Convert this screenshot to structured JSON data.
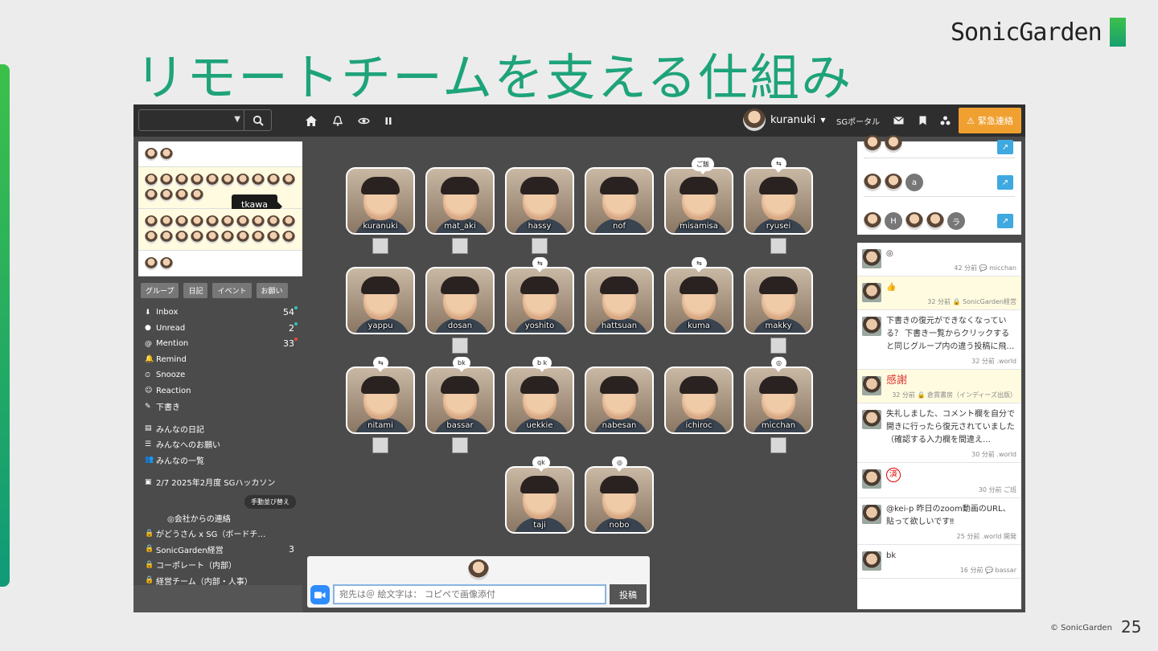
{
  "slide": {
    "title": "リモートチームを支える仕組み",
    "logo": "SonicGarden",
    "copyright": "© SonicGarden",
    "page": "25"
  },
  "topbar": {
    "user": "kuranuki",
    "portal": "SGポータル",
    "urgent": "緊急連絡"
  },
  "tooltip": "tkawa",
  "filters": [
    "グループ",
    "日記",
    "イベント",
    "お願い"
  ],
  "nav": [
    {
      "icon": "⬇",
      "label": "Inbox",
      "count": "54",
      "dot": "#2ec4b6"
    },
    {
      "icon": "●",
      "label": "Unread",
      "count": "2",
      "dot": "#2ec4b6"
    },
    {
      "icon": "@",
      "label": "Mention",
      "count": "33",
      "dot": "#e74c3c"
    },
    {
      "icon": "🔔",
      "label": "Remind",
      "count": "",
      "dot": ""
    },
    {
      "icon": "⏲",
      "label": "Snooze",
      "count": "",
      "dot": ""
    },
    {
      "icon": "☺",
      "label": "Reaction",
      "count": "",
      "dot": ""
    },
    {
      "icon": "✎",
      "label": "下書き",
      "count": "",
      "dot": ""
    }
  ],
  "nav2": [
    {
      "icon": "▤",
      "label": "みんなの日記"
    },
    {
      "icon": "☰",
      "label": "みんなへのお願い"
    },
    {
      "icon": "👥",
      "label": "みんなの一覧"
    }
  ],
  "event": "2/7 2025年2月度 SGハッカソン",
  "sort_button": "手動並び替え",
  "groups": [
    {
      "icon": "",
      "label": "◎会社からの連絡",
      "count": ""
    },
    {
      "icon": "🔒",
      "label": "がどうさん x SG（ボードチ…",
      "count": ""
    },
    {
      "icon": "🔒",
      "label": "SonicGarden経営",
      "count": "3"
    },
    {
      "icon": "🔒",
      "label": "コーポレート（内部）",
      "count": ""
    },
    {
      "icon": "🔒",
      "label": "経営チーム（内部・人事）",
      "count": ""
    }
  ],
  "tiles": [
    {
      "name": "kuranuki",
      "bubble": "",
      "mini": true
    },
    {
      "name": "mat_aki",
      "bubble": "",
      "mini": true
    },
    {
      "name": "hassy",
      "bubble": "",
      "mini": true
    },
    {
      "name": "nof",
      "bubble": "",
      "mini": false
    },
    {
      "name": "misamisa",
      "bubble": "ご飯",
      "mini": false
    },
    {
      "name": "ryusei",
      "bubble": "⇆",
      "mini": true
    },
    {
      "name": "yappu",
      "bubble": "",
      "mini": false
    },
    {
      "name": "dosan",
      "bubble": "",
      "mini": true
    },
    {
      "name": "yoshito",
      "bubble": "⇆",
      "mini": false
    },
    {
      "name": "hattsuan",
      "bubble": "",
      "mini": false
    },
    {
      "name": "kuma",
      "bubble": "⇆",
      "mini": false
    },
    {
      "name": "makky",
      "bubble": "",
      "mini": true
    },
    {
      "name": "nitami",
      "bubble": "⇆",
      "mini": true
    },
    {
      "name": "bassar",
      "bubble": "bk",
      "mini": true
    },
    {
      "name": "uekkie",
      "bubble": "b k",
      "mini": false
    },
    {
      "name": "nabesan",
      "bubble": "",
      "mini": false
    },
    {
      "name": "ichiroc",
      "bubble": "",
      "mini": false
    },
    {
      "name": "micchan",
      "bubble": "◎",
      "mini": true
    },
    {
      "name": "taji",
      "bubble": "qk",
      "mini": false
    },
    {
      "name": "nobo",
      "bubble": "◎",
      "mini": false
    }
  ],
  "compose": {
    "placeholder": "宛先は＠ 絵文字は： コピペで画像添付",
    "post": "投稿"
  },
  "rightbox": {
    "letters": [
      "a",
      "H",
      "ラ"
    ]
  },
  "feed": [
    {
      "text": "◎",
      "meta": "42 分前 💬 micchan",
      "yellow": false,
      "red": false
    },
    {
      "text": "👍",
      "meta": "32 分前 🔒 SonicGarden経営",
      "yellow": true,
      "red": false
    },
    {
      "text": "下書きの復元ができなくなっている？ 下書き一覧からクリックすると同じグループ内の違う投稿に飛…",
      "meta": "32 分前 .world",
      "yellow": false,
      "red": false
    },
    {
      "text": "感謝",
      "meta": "32 分前 🔒 倉貫書房（インディーズ出版）",
      "yellow": true,
      "red": true
    },
    {
      "text": "失礼しました、コメント欄を自分で開きに行ったら復元されていました（確認する入力欄を間違え…",
      "meta": "30 分前 .world",
      "yellow": false,
      "red": false
    },
    {
      "text": "済",
      "meta": "30 分前 ご班",
      "yellow": false,
      "red": false,
      "stamp": true
    },
    {
      "text": "@kei-p 昨日のzoom動画のURL、貼って欲しいです‼",
      "meta": "25 分前 .world 開発",
      "yellow": false,
      "red": false
    },
    {
      "text": "bk",
      "meta": "16 分前 💬 bassar",
      "yellow": false,
      "red": false
    }
  ]
}
